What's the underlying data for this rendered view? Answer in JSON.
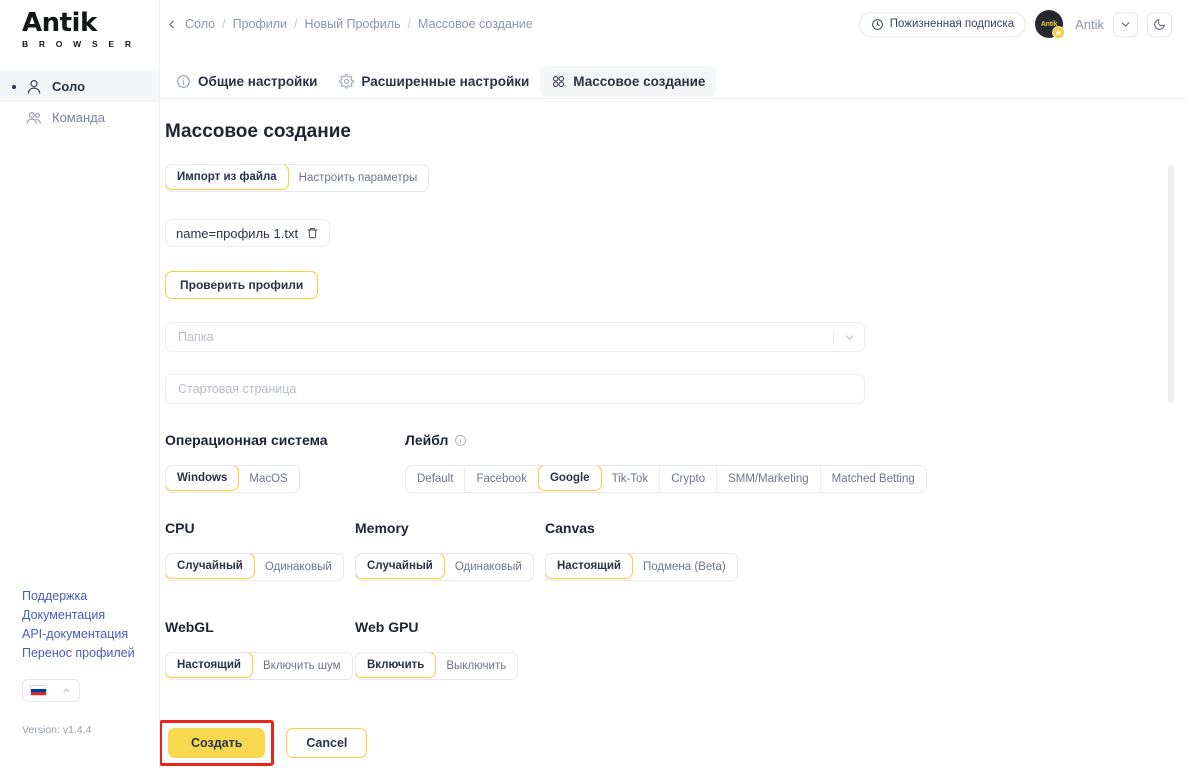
{
  "brand": {
    "name": "Antik",
    "word_mark": "Antik",
    "sub_mark": "B R O W S E R"
  },
  "sidebar": {
    "items": [
      {
        "label": "Соло",
        "icon": "user-icon",
        "active": true
      },
      {
        "label": "Команда",
        "icon": "users-icon",
        "active": false
      }
    ],
    "links": [
      {
        "label": "Поддержка"
      },
      {
        "label": "Документация"
      },
      {
        "label": "API-документация"
      },
      {
        "label": "Перенос профилей"
      }
    ],
    "language": "ru",
    "version": "Version: v1.4.4"
  },
  "header": {
    "breadcrumb": [
      "Соло",
      "Профили",
      "Новый Профиль",
      "Массовое создание"
    ],
    "breadcrumb_separator": "/",
    "subscription_badge": "Пожизненная подписка",
    "user_name": "Antik",
    "avatar_text": "Antik"
  },
  "tabs": [
    {
      "label": "Общие настройки",
      "icon": "info-icon",
      "active": false
    },
    {
      "label": "Расширенные настройки",
      "icon": "gear-icon",
      "active": false
    },
    {
      "label": "Массовое создание",
      "icon": "grid-icon",
      "active": true
    }
  ],
  "main": {
    "page_title": "Массовое создание",
    "mode_toggle": {
      "options": [
        "Импорт из файла",
        "Настроить параметры"
      ],
      "selected": "Импорт из файла"
    },
    "file_chip": {
      "name": "name=профиль 1.txt",
      "delete_icon": "trash-icon"
    },
    "check_button": "Проверить профили",
    "folder_field": {
      "placeholder": "Папка",
      "value": ""
    },
    "start_page_field": {
      "placeholder": "Стартовая страница",
      "value": ""
    },
    "sections": {
      "os": {
        "title": "Операционная система",
        "options": [
          "Windows",
          "MacOS"
        ],
        "selected": "Windows"
      },
      "label": {
        "title": "Лейбл",
        "has_info_icon": true,
        "options": [
          "Default",
          "Facebook",
          "Google",
          "Tik-Tok",
          "Crypto",
          "SMM/Marketing",
          "Matched Betting"
        ],
        "selected": "Google"
      },
      "cpu": {
        "title": "CPU",
        "options": [
          "Случайный",
          "Одинаковый"
        ],
        "selected": "Случайный"
      },
      "memory": {
        "title": "Memory",
        "options": [
          "Случайный",
          "Одинаковый"
        ],
        "selected": "Случайный"
      },
      "canvas": {
        "title": "Canvas",
        "options": [
          "Настоящий",
          "Подмена (Beta)"
        ],
        "selected": "Настоящий"
      },
      "webgl": {
        "title": "WebGL",
        "options": [
          "Настоящий",
          "Включить шум"
        ],
        "selected": "Настоящий"
      },
      "webgpu": {
        "title": "Web GPU",
        "options": [
          "Включить",
          "Выключить"
        ],
        "selected": "Включить"
      }
    },
    "actions": {
      "create": "Создать",
      "cancel": "Cancel"
    }
  },
  "colors": {
    "accent_yellow": "#F7D84E",
    "accent_border": "#F5CF3C",
    "highlight_red": "#E8241F",
    "text_dark": "#2B3245",
    "text_muted": "#8E95A6",
    "link_blue": "#4A5BB9"
  }
}
